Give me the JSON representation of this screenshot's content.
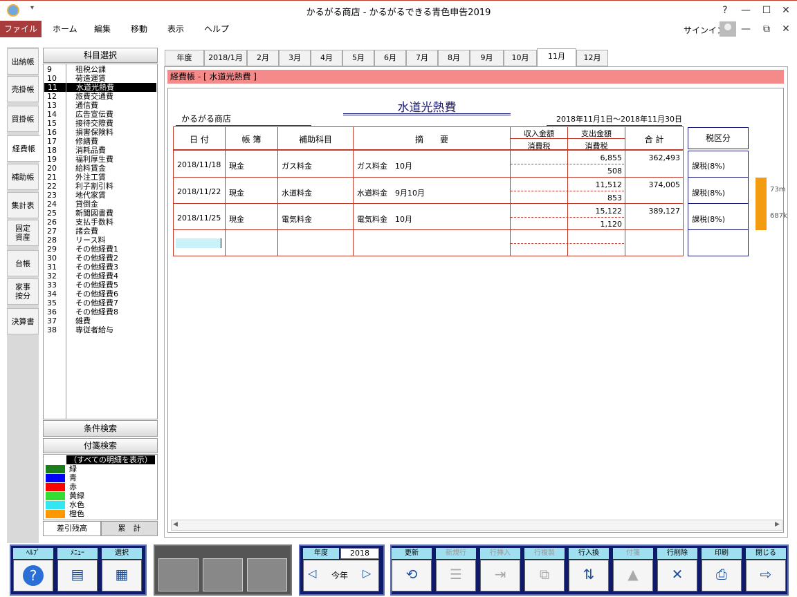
{
  "window": {
    "title": "かるがる商店 - かるがるできる青色申告2019",
    "help": "?",
    "minimize": "—",
    "maximize": "☐",
    "close": "✕"
  },
  "menu": {
    "file": "ファイル",
    "home": "ホーム",
    "edit": "編集",
    "move": "移動",
    "view": "表示",
    "help": "ヘルプ",
    "signin": "サインイン",
    "sub_min": "—",
    "sub_restore": "⧉",
    "sub_close": "✕"
  },
  "left_tabs": [
    "出納帳",
    "売掛帳",
    "買掛帳",
    "経費帳",
    "補助帳",
    "集計表",
    "固定\n資産",
    "台帳",
    "家事\n按分",
    "決算書"
  ],
  "account_panel": {
    "header": "科目選択",
    "items": [
      {
        "no": "9",
        "name": "租税公課"
      },
      {
        "no": "10",
        "name": "荷造運賃"
      },
      {
        "no": "11",
        "name": "水道光熱費"
      },
      {
        "no": "12",
        "name": "旅費交通費"
      },
      {
        "no": "13",
        "name": "通信費"
      },
      {
        "no": "14",
        "name": "広告宣伝費"
      },
      {
        "no": "15",
        "name": "接待交際費"
      },
      {
        "no": "16",
        "name": "損害保険料"
      },
      {
        "no": "17",
        "name": "修繕費"
      },
      {
        "no": "18",
        "name": "消耗品費"
      },
      {
        "no": "19",
        "name": "福利厚生費"
      },
      {
        "no": "20",
        "name": "給料賃金"
      },
      {
        "no": "21",
        "name": "外注工賃"
      },
      {
        "no": "22",
        "name": "利子割引料"
      },
      {
        "no": "23",
        "name": "地代家賃"
      },
      {
        "no": "24",
        "name": "貸倒金"
      },
      {
        "no": "25",
        "name": "新聞図書費"
      },
      {
        "no": "26",
        "name": "支払手数料"
      },
      {
        "no": "27",
        "name": "諸会費"
      },
      {
        "no": "28",
        "name": "リース料"
      },
      {
        "no": "29",
        "name": "その他経費1"
      },
      {
        "no": "30",
        "name": "その他経費2"
      },
      {
        "no": "31",
        "name": "その他経費3"
      },
      {
        "no": "32",
        "name": "その他経費4"
      },
      {
        "no": "33",
        "name": "その他経費5"
      },
      {
        "no": "34",
        "name": "その他経費6"
      },
      {
        "no": "35",
        "name": "その他経費7"
      },
      {
        "no": "36",
        "name": "その他経費8"
      },
      {
        "no": "37",
        "name": "雑費"
      },
      {
        "no": "38",
        "name": "専従者給与"
      }
    ],
    "selected_index": 2,
    "condition_search": "条件検索",
    "tag_search": "付箋検索",
    "tag_all": "（すべての明細を表示）",
    "tags": [
      {
        "label": "緑",
        "color": "#1a7f1a"
      },
      {
        "label": "青",
        "color": "#0000ff"
      },
      {
        "label": "赤",
        "color": "#ff0000"
      },
      {
        "label": "黄緑",
        "color": "#33dd33"
      },
      {
        "label": "水色",
        "color": "#33e6f2"
      },
      {
        "label": "橙色",
        "color": "#ff9900"
      }
    ],
    "balance_tab": "差引残高",
    "cumulative_tab": "累　計"
  },
  "month_tabs": [
    "年度",
    "2018/1月",
    "2月",
    "3月",
    "4月",
    "5月",
    "6月",
    "7月",
    "8月",
    "9月",
    "10月",
    "11月",
    "12月"
  ],
  "active_month_index": 11,
  "ledger": {
    "header_bar": "経費帳 - [ 水道光熱費 ]",
    "title": "水道光熱費",
    "company": "かるがる商店",
    "period": "2018年11月1日～2018年11月30日",
    "columns": {
      "date": "日 付",
      "book": "帳 簿",
      "sub": "補助科目",
      "desc": "摘　　要",
      "income": "収入金額",
      "income_tax": "消費税",
      "expense": "支出金額",
      "expense_tax": "消費税",
      "total": "合 計",
      "tax_class": "税区分"
    },
    "rows": [
      {
        "date": "2018/11/18",
        "book": "現金",
        "sub": "ガス料金",
        "desc": "ガス料金　10月",
        "income": "",
        "income_tax": "",
        "expense": "6,855",
        "expense_tax": "508",
        "total": "362,493",
        "tax": "課税(8%)",
        "tag": ""
      },
      {
        "date": "2018/11/22",
        "book": "現金",
        "sub": "水道料金",
        "desc": "水道料金　9月10月",
        "income": "",
        "income_tax": "",
        "expense": "11,512",
        "expense_tax": "853",
        "total": "374,005",
        "tax": "課税(8%)",
        "tag": "73m"
      },
      {
        "date": "2018/11/25",
        "book": "現金",
        "sub": "電気料金",
        "desc": "電気料金　10月",
        "income": "",
        "income_tax": "",
        "expense": "15,122",
        "expense_tax": "1,120",
        "total": "389,127",
        "tax": "課税(8%)",
        "tag": "687k"
      }
    ],
    "tag_color": "#f39c12"
  },
  "toolbar": {
    "help": "ﾍﾙﾌﾟ",
    "menu": "ﾒﾆｭｰ",
    "select": "選択",
    "year_label": "年度",
    "year_value": "2018",
    "this_year": "今年",
    "refresh": "更新",
    "new_row": "新規行",
    "insert_row": "行挿入",
    "copy_row": "行複製",
    "swap_row": "行入換",
    "tag": "付箋",
    "delete_row": "行削除",
    "print": "印刷",
    "close": "閉じる"
  }
}
